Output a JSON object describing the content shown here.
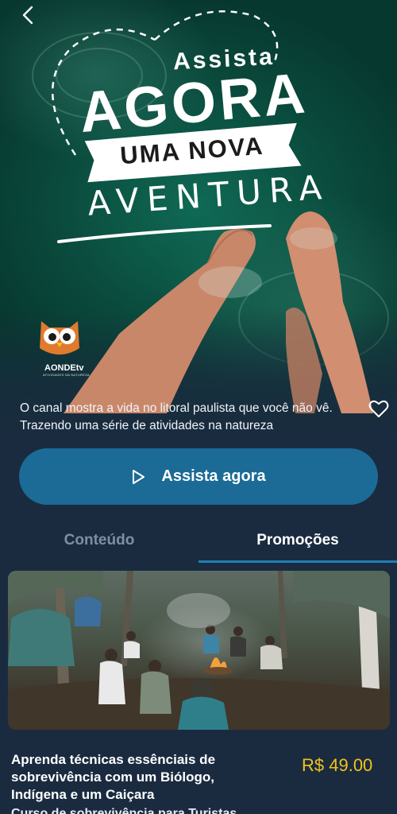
{
  "hero": {
    "title_small": "Assista",
    "title_big": "AGORA",
    "ribbon": "UMA NOVA",
    "title_script": "AVENTURA",
    "logo": {
      "name": "AONDEtv",
      "tagline": "ATIVIDADES NA NATUREZA"
    },
    "description": "O canal mostra a vida no litoral paulista que você não vê. Trazendo uma série de atividades na natureza"
  },
  "actions": {
    "watch_label": "Assista agora"
  },
  "tabs": [
    {
      "label": "Conteúdo",
      "active": false
    },
    {
      "label": "Promoções",
      "active": true
    }
  ],
  "card": {
    "title": "Aprenda técnicas essênciais de sobrevivência com um Biólogo, Indígena e um Caiçara",
    "subtitle": "Curso de sobrevivência para Turistas",
    "price": "R$ 49.00"
  },
  "colors": {
    "background": "#1a2b40",
    "button": "#1b6b96",
    "tab_indicator": "#1f7fb3",
    "price": "#f2c21b",
    "water": "#0f6a55"
  },
  "icons": [
    "back-arrow-icon",
    "heart-outline-icon",
    "play-icon",
    "owl-logo-icon"
  ]
}
